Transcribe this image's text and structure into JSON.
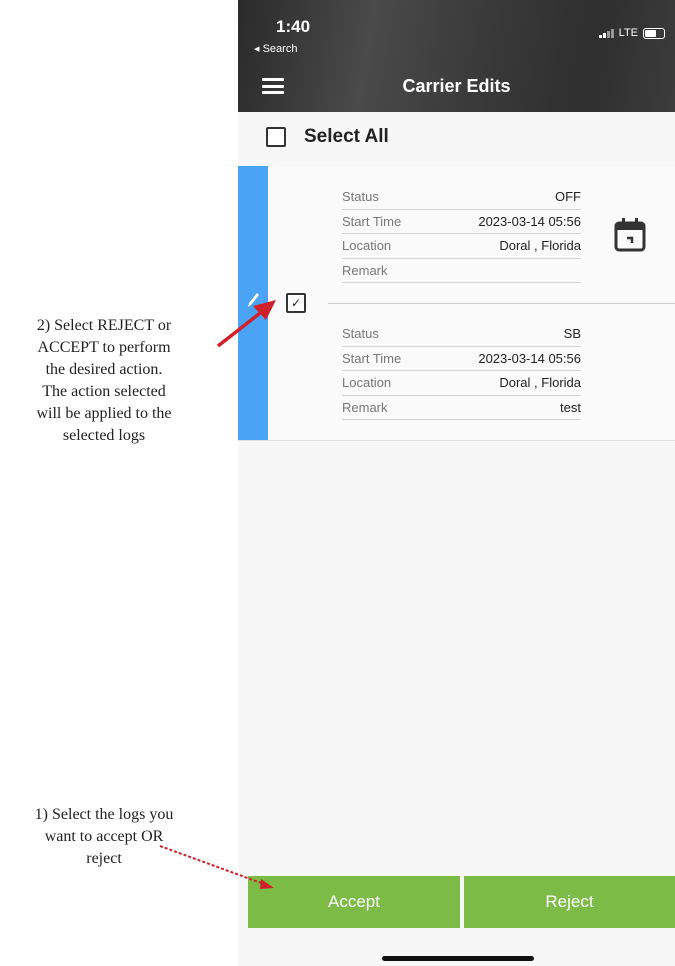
{
  "annotations": {
    "note_reject_accept": "2) Select REJECT or\nACCEPT to perform\nthe desired action.\nThe action selected\nwill be applied to the\nselected logs",
    "note_select_logs": "1) Select the logs you\nwant to accept OR\nreject",
    "arrow_color": "#d0202a"
  },
  "status_bar": {
    "time": "1:40",
    "back_label": "◂ Search",
    "network": "LTE"
  },
  "nav": {
    "title": "Carrier Edits"
  },
  "select_all": {
    "label": "Select All",
    "checked": false
  },
  "logs": [
    {
      "status_label": "Status",
      "status": "OFF",
      "start_label": "Start Time",
      "start": "2023-03-14  05:56",
      "location_label": "Location",
      "location": "Doral , Florida",
      "remark_label": "Remark",
      "remark": ""
    },
    {
      "status_label": "Status",
      "status": "SB",
      "start_label": "Start Time",
      "start": "2023-03-14  05:56",
      "location_label": "Location",
      "location": "Doral , Florida",
      "remark_label": "Remark",
      "remark": "test"
    }
  ],
  "record": {
    "checked": true,
    "check_glyph": "✓"
  },
  "actions": {
    "accept": "Accept",
    "reject": "Reject"
  },
  "colors": {
    "accent_blue": "#4aa3f5",
    "button_green": "#7dbb47"
  },
  "icons": [
    "hamburger-menu-icon",
    "pencil-icon",
    "calendar-icon",
    "signal-icon",
    "battery-icon"
  ]
}
